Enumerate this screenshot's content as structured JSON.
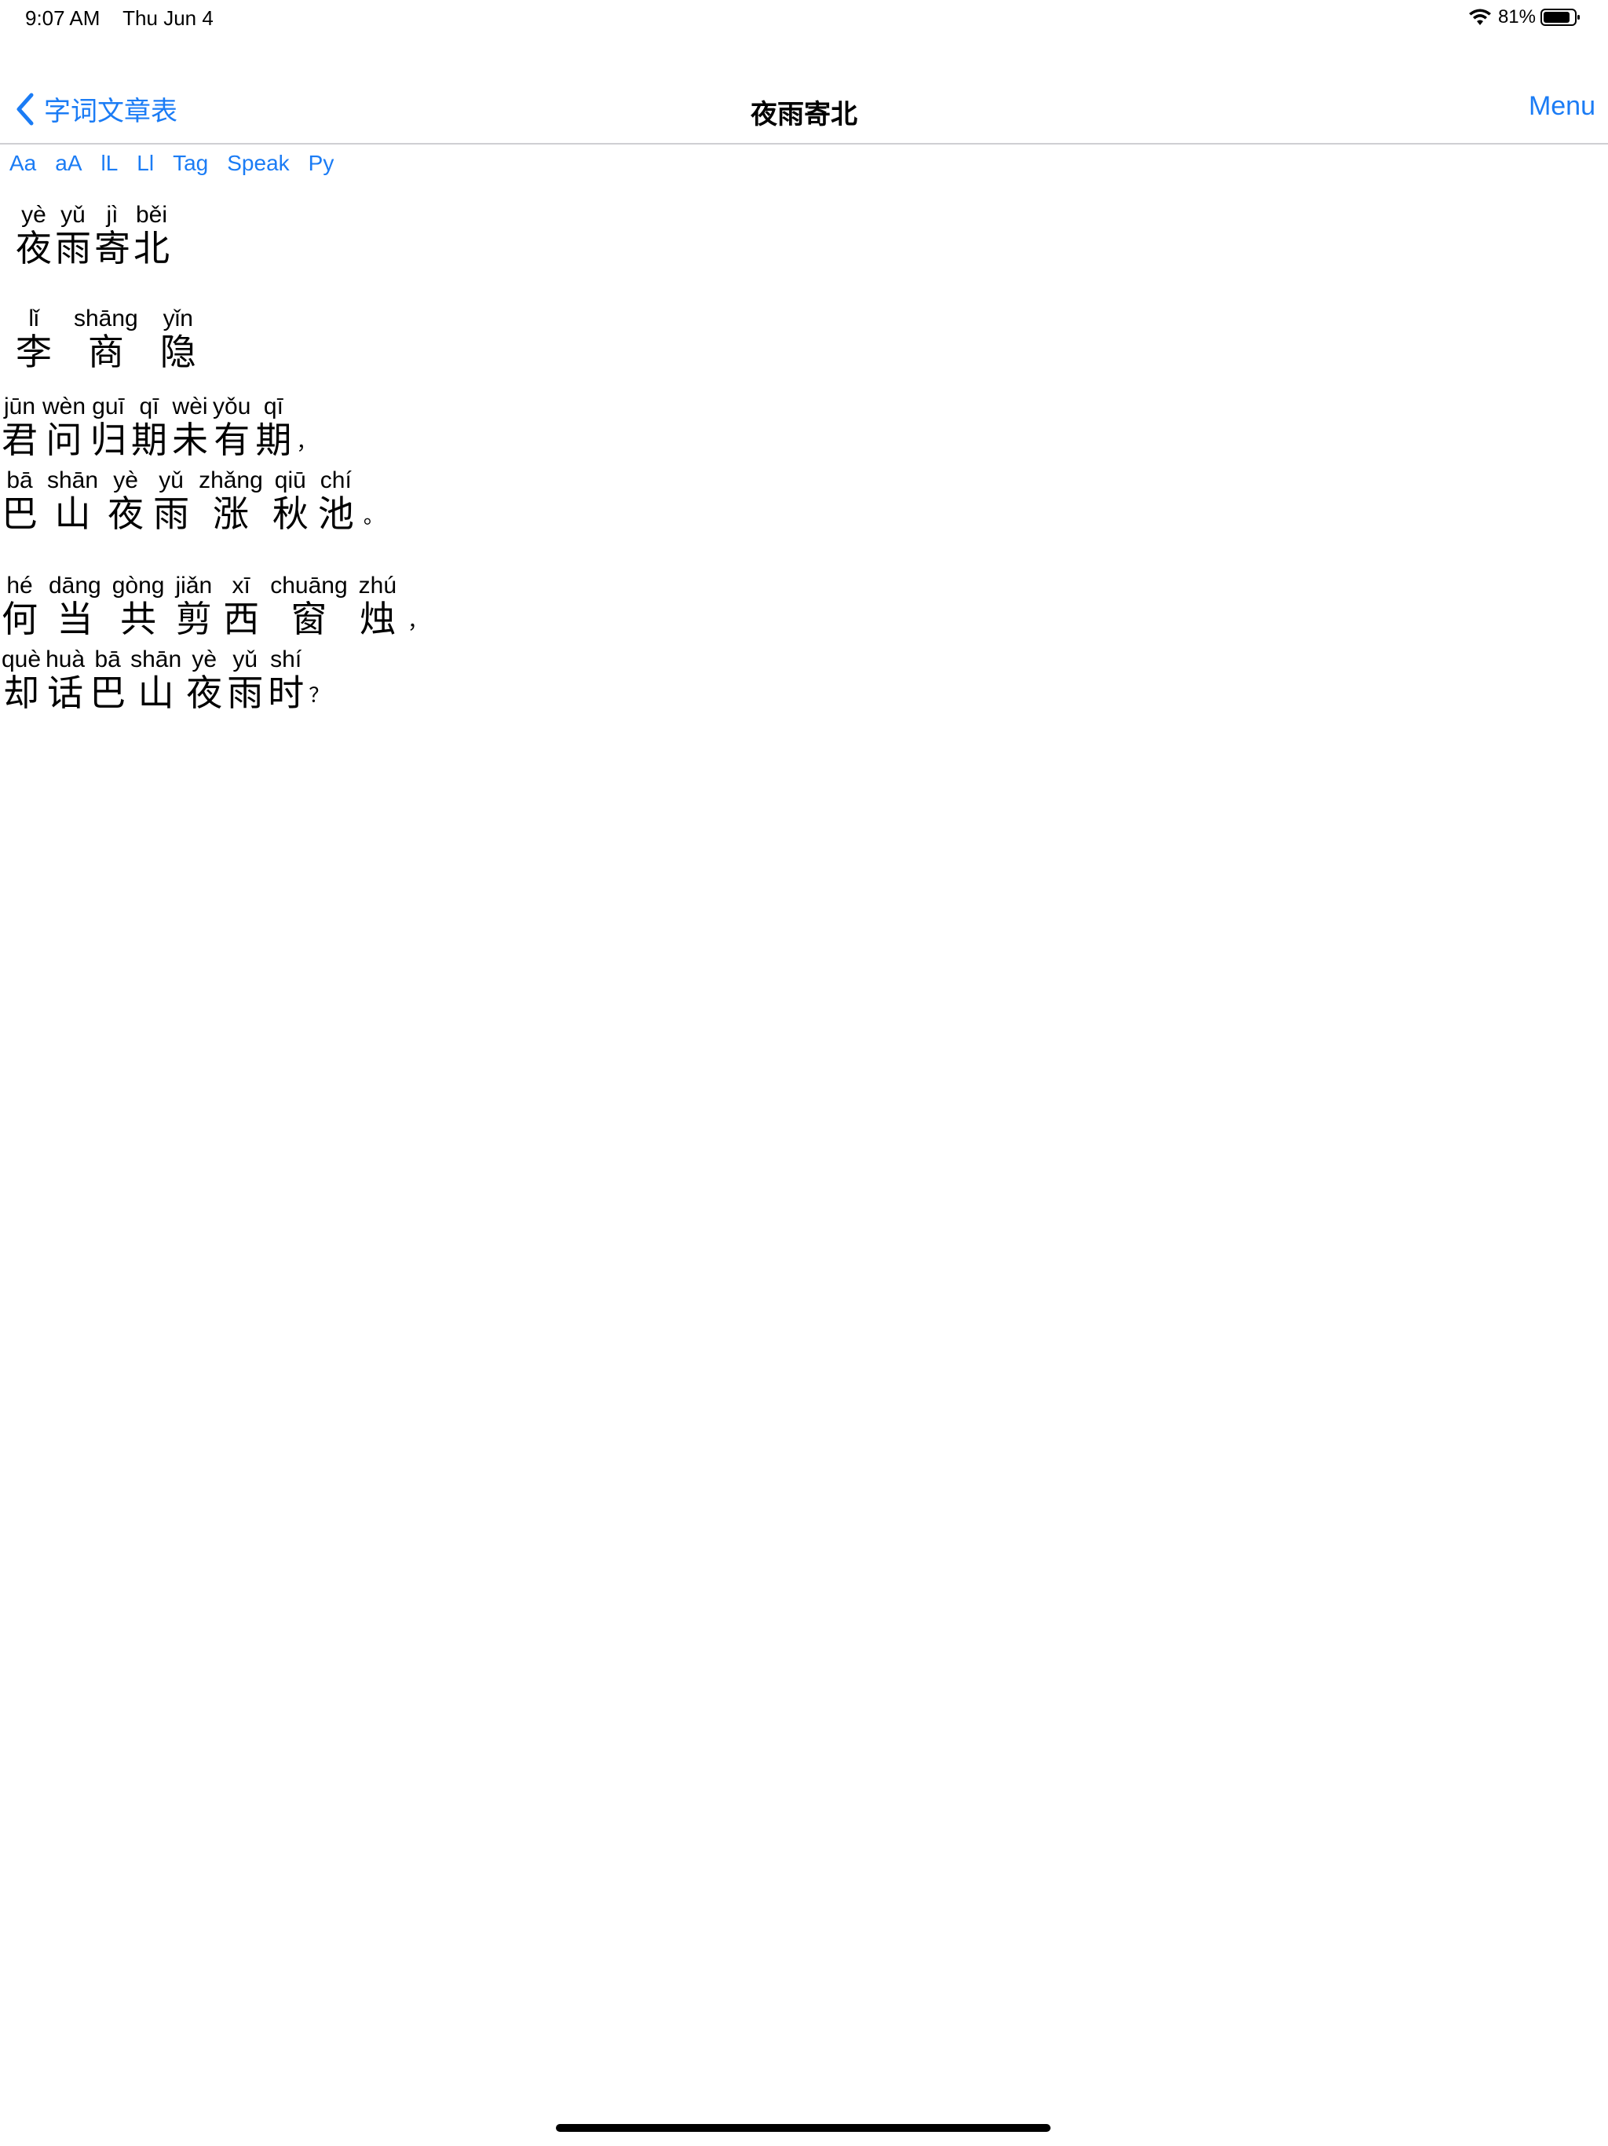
{
  "status": {
    "time": "9:07 AM",
    "date": "Thu Jun 4",
    "battery": "81%"
  },
  "nav": {
    "back_label": "字词文章表",
    "title": "夜雨寄北",
    "menu_label": "Menu"
  },
  "toolbar": [
    "Aa",
    "aA",
    "lL",
    "Ll",
    "Tag",
    "Speak",
    "Py"
  ],
  "poem": {
    "title": [
      {
        "py": "yè",
        "hz": "夜"
      },
      {
        "py": "yǔ",
        "hz": "雨"
      },
      {
        "py": "jì",
        "hz": "寄"
      },
      {
        "py": "běi",
        "hz": "北"
      }
    ],
    "author": [
      {
        "py": "lǐ",
        "hz": "李"
      },
      {
        "py": "shāng",
        "hz": "商"
      },
      {
        "py": "yǐn",
        "hz": "隐"
      }
    ],
    "lines": [
      {
        "units": [
          {
            "py": "jūn",
            "hz": "君"
          },
          {
            "py": "wèn",
            "hz": "问"
          },
          {
            "py": "guī",
            "hz": "归"
          },
          {
            "py": "qī",
            "hz": "期"
          },
          {
            "py": "wèi",
            "hz": "未"
          },
          {
            "py": "yǒu",
            "hz": "有"
          },
          {
            "py": "qī",
            "hz": "期"
          }
        ],
        "punct": "，"
      },
      {
        "units": [
          {
            "py": "bā",
            "hz": "巴"
          },
          {
            "py": "shān",
            "hz": "山"
          },
          {
            "py": "yè",
            "hz": "夜"
          },
          {
            "py": "yǔ",
            "hz": "雨"
          },
          {
            "py": "zhǎng",
            "hz": "涨"
          },
          {
            "py": "qiū",
            "hz": "秋"
          },
          {
            "py": "chí",
            "hz": "池"
          }
        ],
        "punct": "。"
      },
      {
        "units": [
          {
            "py": "hé",
            "hz": "何"
          },
          {
            "py": "dāng",
            "hz": "当"
          },
          {
            "py": "gòng",
            "hz": "共"
          },
          {
            "py": "jiǎn",
            "hz": "剪"
          },
          {
            "py": "xī",
            "hz": "西"
          },
          {
            "py": "chuāng",
            "hz": "窗"
          },
          {
            "py": "zhú",
            "hz": "烛"
          }
        ],
        "punct": "，"
      },
      {
        "units": [
          {
            "py": "què",
            "hz": "却"
          },
          {
            "py": "huà",
            "hz": "话"
          },
          {
            "py": "bā",
            "hz": "巴"
          },
          {
            "py": "shān",
            "hz": "山"
          },
          {
            "py": "yè",
            "hz": "夜"
          },
          {
            "py": "yǔ",
            "hz": "雨"
          },
          {
            "py": "shí",
            "hz": "时"
          }
        ],
        "punct": "？"
      }
    ]
  }
}
